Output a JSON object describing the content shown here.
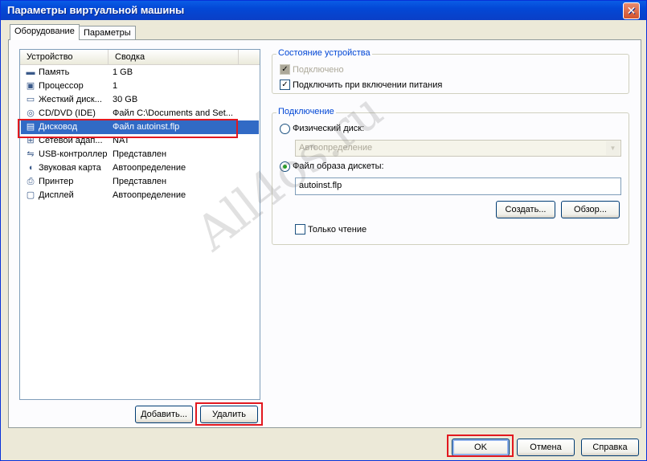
{
  "window": {
    "title": "Параметры виртуальной машины",
    "close_glyph": "✕"
  },
  "tabs": [
    {
      "label": "Оборудование",
      "active": true
    },
    {
      "label": "Параметры",
      "active": false
    }
  ],
  "device_list": {
    "columns": [
      "Устройство",
      "Сводка"
    ],
    "rows": [
      {
        "icon": "memory-icon",
        "glyph": "▬",
        "device": "Память",
        "summary": "1 GB"
      },
      {
        "icon": "processor-icon",
        "glyph": "▣",
        "device": "Процессор",
        "summary": "1"
      },
      {
        "icon": "hard-disk-icon",
        "glyph": "▭",
        "device": "Жесткий диск...",
        "summary": "30 GB"
      },
      {
        "icon": "cd-dvd-icon",
        "glyph": "◎",
        "device": "CD/DVD (IDE)",
        "summary": "Файл C:\\Documents and Set..."
      },
      {
        "icon": "floppy-icon",
        "glyph": "▤",
        "device": "Дисковод",
        "summary": "Файл autoinst.flp",
        "selected": true
      },
      {
        "icon": "network-icon",
        "glyph": "⊞",
        "device": "Сетевой адап...",
        "summary": "NAT"
      },
      {
        "icon": "usb-icon",
        "glyph": "⇋",
        "device": "USB-контроллер",
        "summary": "Представлен"
      },
      {
        "icon": "sound-icon",
        "glyph": "◖",
        "device": "Звуковая карта",
        "summary": "Автоопределение"
      },
      {
        "icon": "printer-icon",
        "glyph": "⎙",
        "device": "Принтер",
        "summary": "Представлен"
      },
      {
        "icon": "display-icon",
        "glyph": "▢",
        "device": "Дисплей",
        "summary": "Автоопределение"
      }
    ]
  },
  "list_buttons": {
    "add": "Добавить...",
    "remove": "Удалить"
  },
  "device_status": {
    "title": "Состояние устройства",
    "connected": {
      "label": "Подключено",
      "checked": true,
      "enabled": false
    },
    "connect_at_power_on": {
      "label": "Подключить при включении питания",
      "checked": true
    }
  },
  "connection": {
    "title": "Подключение",
    "physical_disk": {
      "label": "Физический диск:",
      "selected": false
    },
    "physical_disk_combo": "Автоопределение",
    "floppy_image": {
      "label": "Файл образа дискеты:",
      "selected": true
    },
    "image_path": "autoinst.flp",
    "create_button": "Создать...",
    "browse_button": "Обзор...",
    "read_only": {
      "label": "Только чтение",
      "checked": false
    }
  },
  "footer": {
    "ok": "OK",
    "cancel": "Отмена",
    "help": "Справка"
  },
  "watermark": "All4os.ru",
  "colors": {
    "selection": "#316ac5",
    "highlight_box": "#e2181f",
    "titlebar": "#0348d6"
  }
}
